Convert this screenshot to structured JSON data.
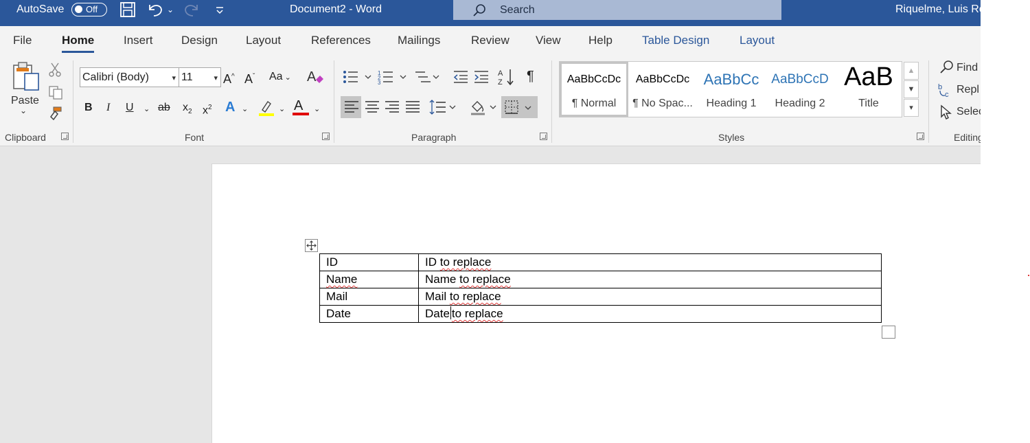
{
  "titlebar": {
    "autosave_label": "AutoSave",
    "autosave_state": "Off",
    "document_title": "Document2  -  Word",
    "search_placeholder": "Search",
    "user_name": "Riquelme, Luis Ro",
    "icons": [
      "save-icon",
      "undo-icon",
      "redo-icon",
      "customize-qat-icon",
      "search-icon"
    ]
  },
  "tabs": [
    "File",
    "Home",
    "Insert",
    "Design",
    "Layout",
    "References",
    "Mailings",
    "Review",
    "View",
    "Help",
    "Table Design",
    "Layout"
  ],
  "active_tab": "Home",
  "ribbon": {
    "clipboard": {
      "label": "Clipboard",
      "paste_label": "Paste"
    },
    "font": {
      "label": "Font",
      "font_name": "Calibri (Body)",
      "font_size": "11",
      "case_label": "Aa",
      "bold": "B",
      "italic": "I",
      "underline": "U",
      "strike": "ab",
      "subscript": "x",
      "superscript": "x",
      "sub_mark": "2",
      "sup_mark": "2",
      "text_effects": "A",
      "font_color": "A"
    },
    "paragraph": {
      "label": "Paragraph",
      "pilcrow": "¶"
    },
    "styles": {
      "label": "Styles",
      "items": [
        {
          "preview": "AaBbCcDc",
          "name": "¶ Normal"
        },
        {
          "preview": "AaBbCcDc",
          "name": "¶ No Spac..."
        },
        {
          "preview": "AaBbCc",
          "name": "Heading 1"
        },
        {
          "preview": "AaBbCcD",
          "name": "Heading 2"
        },
        {
          "preview": "AaB",
          "name": "Title"
        }
      ]
    },
    "editing": {
      "label": "Editing",
      "find": "Find",
      "replace": "Repl",
      "select": "Selec"
    }
  },
  "colors": {
    "accent": "#2b579a",
    "highlight": "#ffff00",
    "font_color": "#e00000",
    "spell_error": "#e03a3a"
  },
  "table": {
    "rows": [
      {
        "key": "ID",
        "value": "ID to replace"
      },
      {
        "key": "Name",
        "value": "Name to replace"
      },
      {
        "key": "Mail",
        "value": "Mail to replace"
      },
      {
        "key": "Date",
        "value": "Date to replace"
      }
    ],
    "value_suffix": "to replace",
    "cursor_row": 3
  }
}
